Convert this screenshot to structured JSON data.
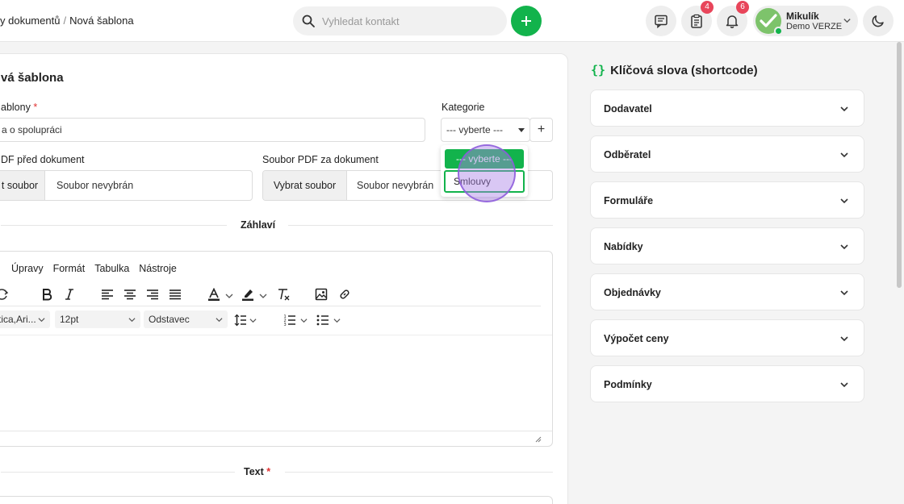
{
  "breadcrumb": {
    "parent": "y dokumentů",
    "separator": "/",
    "current": "Nová šablona"
  },
  "search": {
    "placeholder": "Vyhledat kontakt",
    "icon": "search-icon"
  },
  "header": {
    "add_icon": "plus-icon",
    "chat_icon": "message-icon",
    "tasks_icon": "clipboard-icon",
    "tasks_count": "4",
    "notifications_icon": "bell-icon",
    "notifications_count": "6",
    "theme_icon": "moon-icon"
  },
  "user": {
    "name": "Mikulík",
    "company": "Demo VERZE",
    "status_color": "#12b34c"
  },
  "form": {
    "title": "vá šablona",
    "name_label": "ablony",
    "required_mark": "*",
    "name_value": "a o spolupráci",
    "category_label": "Kategorie",
    "category_value": "--- vyberte ---",
    "category_add": "+",
    "pdf_before_label": "DF před dokument",
    "pdf_before_button": "t soubor",
    "pdf_before_value": "Soubor nevybrán",
    "pdf_after_label": "Soubor PDF za dokument",
    "pdf_after_button": "Vybrat soubor",
    "pdf_after_value": "Soubor nevybrán",
    "header_section": "Záhlaví",
    "text_section": "Text"
  },
  "editor": {
    "menu": [
      "Úpravy",
      "Formát",
      "Tabulka",
      "Nástroje"
    ],
    "font_family": "tica,Ari...",
    "font_size": "12pt",
    "block_format": "Odstavec"
  },
  "dropdown": {
    "options": [
      "--- vyberte ---",
      "Smlouvy"
    ],
    "selected_index": 0,
    "highlighted_index": 1
  },
  "shortcodes": {
    "title": "Klíčová slova (shortcode)",
    "bracket": "{}",
    "items": [
      "Dodavatel",
      "Odběratel",
      "Formuláře",
      "Nabídky",
      "Objednávky",
      "Výpočet ceny",
      "Podmínky"
    ]
  },
  "colors": {
    "accent": "#12b34c",
    "badge": "#e8455a",
    "required": "#e03131"
  }
}
